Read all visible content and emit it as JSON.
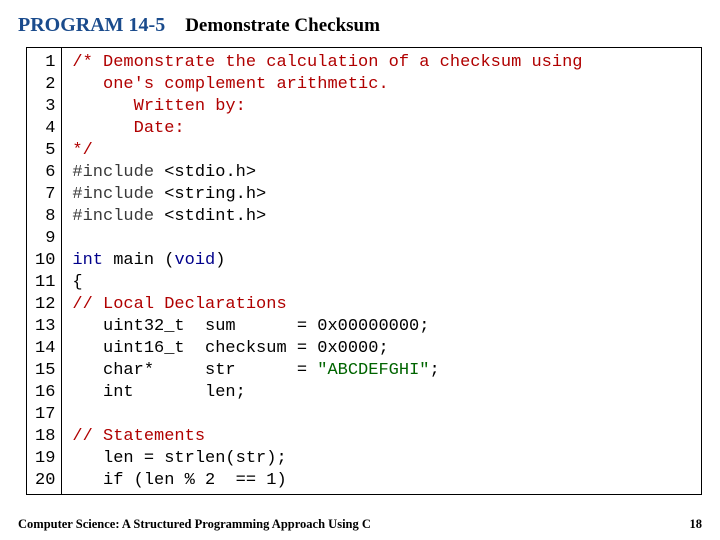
{
  "header": {
    "program_label": "PROGRAM 14-5",
    "program_title": "Demonstrate Checksum"
  },
  "code": {
    "lines": [
      {
        "n": 1,
        "tokens": [
          {
            "t": "/* Demonstrate the calculation of a checksum using",
            "c": "comment"
          }
        ]
      },
      {
        "n": 2,
        "tokens": [
          {
            "t": "   one's complement arithmetic.",
            "c": "comment"
          }
        ]
      },
      {
        "n": 3,
        "tokens": [
          {
            "t": "      Written by:",
            "c": "comment"
          }
        ]
      },
      {
        "n": 4,
        "tokens": [
          {
            "t": "      Date:",
            "c": "comment"
          }
        ]
      },
      {
        "n": 5,
        "tokens": [
          {
            "t": "*/",
            "c": "comment"
          }
        ]
      },
      {
        "n": 6,
        "tokens": [
          {
            "t": "#include ",
            "c": "preproc"
          },
          {
            "t": "<stdio.h>",
            "c": "plain"
          }
        ]
      },
      {
        "n": 7,
        "tokens": [
          {
            "t": "#include ",
            "c": "preproc"
          },
          {
            "t": "<string.h>",
            "c": "plain"
          }
        ]
      },
      {
        "n": 8,
        "tokens": [
          {
            "t": "#include ",
            "c": "preproc"
          },
          {
            "t": "<stdint.h>",
            "c": "plain"
          }
        ]
      },
      {
        "n": 9,
        "tokens": [
          {
            "t": "",
            "c": "plain"
          }
        ]
      },
      {
        "n": 10,
        "tokens": [
          {
            "t": "int",
            "c": "type"
          },
          {
            "t": " main (",
            "c": "plain"
          },
          {
            "t": "void",
            "c": "keyword"
          },
          {
            "t": ")",
            "c": "plain"
          }
        ]
      },
      {
        "n": 11,
        "tokens": [
          {
            "t": "{",
            "c": "plain"
          }
        ]
      },
      {
        "n": 12,
        "tokens": [
          {
            "t": "// Local Declarations",
            "c": "comment"
          }
        ]
      },
      {
        "n": 13,
        "tokens": [
          {
            "t": "   uint32_t  sum      = 0x00000000;",
            "c": "plain"
          }
        ]
      },
      {
        "n": 14,
        "tokens": [
          {
            "t": "   uint16_t  checksum = 0x0000;",
            "c": "plain"
          }
        ]
      },
      {
        "n": 15,
        "tokens": [
          {
            "t": "   char*     str      = ",
            "c": "plain"
          },
          {
            "t": "\"ABCDEFGHI\"",
            "c": "string"
          },
          {
            "t": ";",
            "c": "plain"
          }
        ]
      },
      {
        "n": 16,
        "tokens": [
          {
            "t": "   int       len;",
            "c": "plain"
          }
        ]
      },
      {
        "n": 17,
        "tokens": [
          {
            "t": "",
            "c": "plain"
          }
        ]
      },
      {
        "n": 18,
        "tokens": [
          {
            "t": "// Statements",
            "c": "comment"
          }
        ]
      },
      {
        "n": 19,
        "tokens": [
          {
            "t": "   len = strlen(str);",
            "c": "plain"
          }
        ]
      },
      {
        "n": 20,
        "tokens": [
          {
            "t": "   if (len % 2  == 1)",
            "c": "plain"
          }
        ]
      }
    ]
  },
  "footer": {
    "book_title": "Computer Science: A Structured Programming Approach Using C",
    "page_number": "18"
  }
}
